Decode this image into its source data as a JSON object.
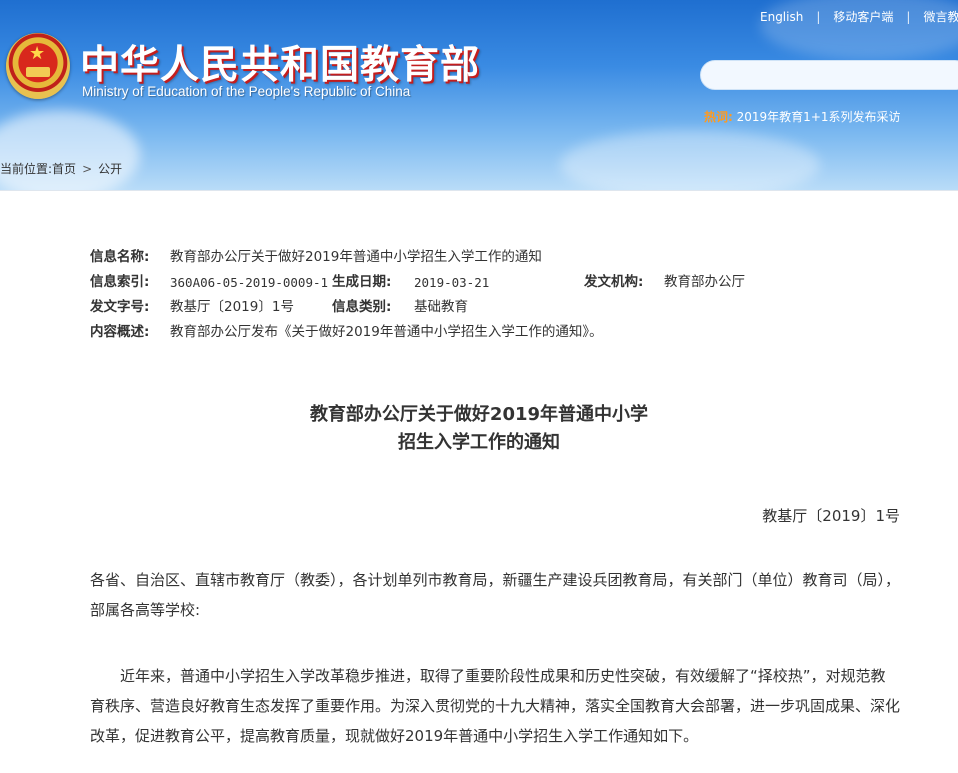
{
  "header": {
    "title_cn": "中华人民共和国教育部",
    "title_en": "Ministry of Education of the People's Republic of China",
    "links": [
      "English",
      "移动客户端",
      "微言教育"
    ],
    "search_placeholder": "",
    "hot_label": "热词:",
    "hot_link": "2019年教育1+1系列发布采访"
  },
  "breadcrumb": {
    "prefix": "当前位置:",
    "items": [
      "首页",
      "公开"
    ],
    "separator": ">"
  },
  "meta": {
    "name_label": "信息名称:",
    "name_value": "教育部办公厅关于做好2019年普通中小学招生入学工作的通知",
    "index_label": "信息索引:",
    "index_value": "360A06-05-2019-0009-1",
    "date_label": "生成日期:",
    "date_value": "2019-03-21",
    "org_label": "发文机构:",
    "org_value": "教育部办公厅",
    "docno_label": "发文字号:",
    "docno_value": "教基厅〔2019〕1号",
    "category_label": "信息类别:",
    "category_value": "基础教育",
    "summary_label": "内容概述:",
    "summary_value": "教育部办公厅发布《关于做好2019年普通中小学招生入学工作的通知》。"
  },
  "document": {
    "title_line1": "教育部办公厅关于做好2019年普通中小学",
    "title_line2": "招生入学工作的通知",
    "doc_number": "教基厅〔2019〕1号",
    "addressee": "各省、自治区、直辖市教育厅（教委），各计划单列市教育局，新疆生产建设兵团教育局，有关部门（单位）教育司（局），部属各高等学校:",
    "paragraph1": "近年来，普通中小学招生入学改革稳步推进，取得了重要阶段性成果和历史性突破，有效缓解了“择校热”，对规范教育秩序、营造良好教育生态发挥了重要作用。为深入贯彻党的十九大精神，落实全国教育大会部署，进一步巩固成果、深化改革，促进教育公平，提高教育质量，现就做好2019年普通中小学招生入学工作通知如下。"
  },
  "colors": {
    "header_blue": "#1f6fd0",
    "title_shadow_red": "#c41d1d",
    "hot_orange": "#ff9a1f"
  }
}
